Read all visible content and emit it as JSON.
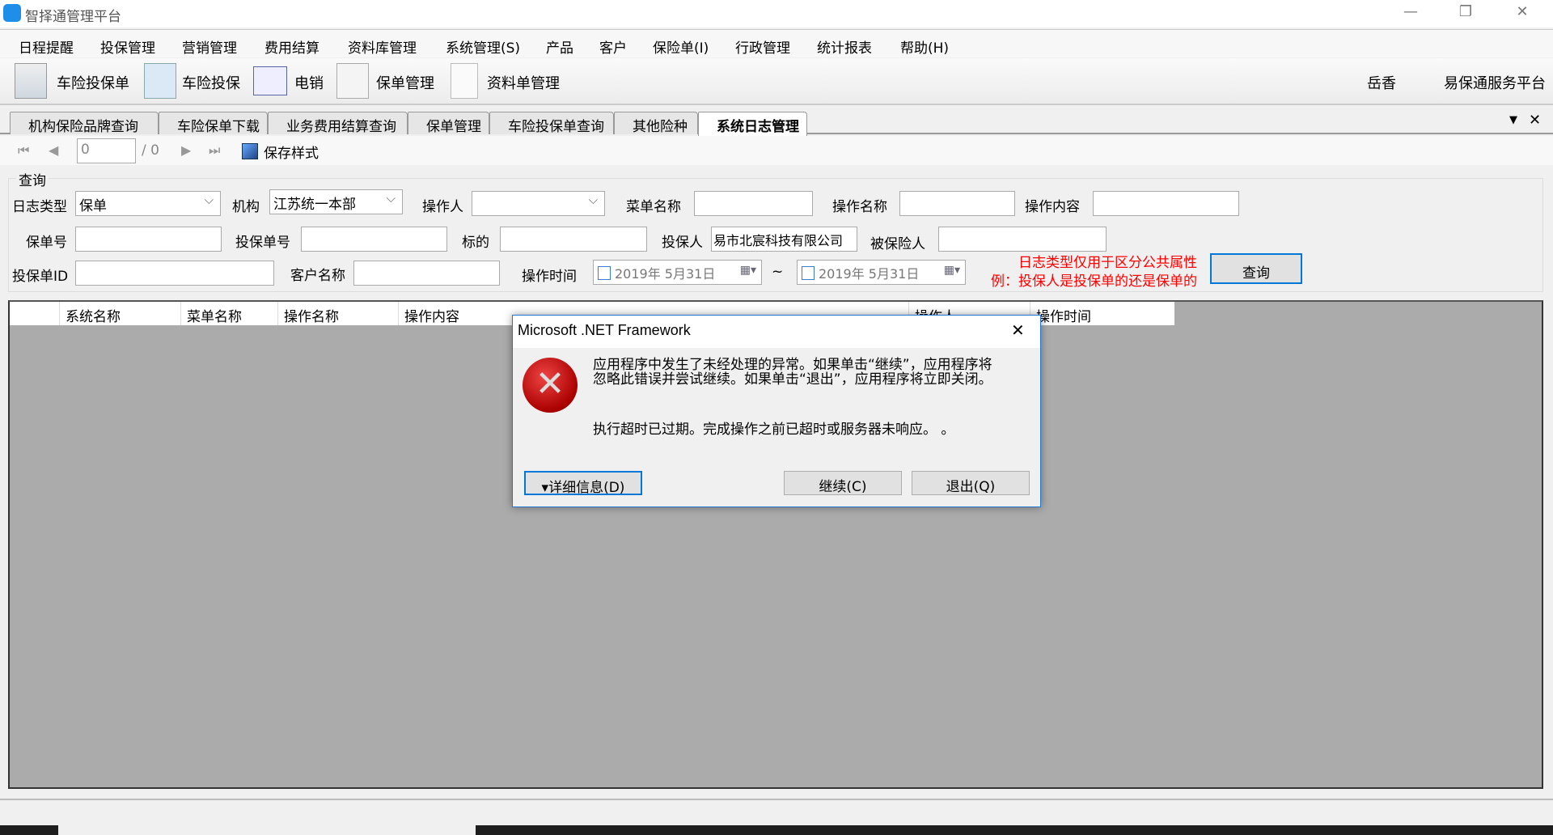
{
  "window": {
    "title": "智择通管理平台",
    "minimize": "—",
    "restore": "❐",
    "close": "✕"
  },
  "menu": [
    "日程提醒",
    "投保管理",
    "营销管理",
    "费用结算",
    "资料库管理",
    "系统管理(S)",
    "产品",
    "客户",
    "保险单(I)",
    "行政管理",
    "统计报表",
    "帮助(H)"
  ],
  "toolbar": {
    "items": [
      "车险投保单",
      "车险投保",
      "电销",
      "保单管理",
      "资料单管理"
    ],
    "user": "岳香",
    "platform": "易保通服务平台"
  },
  "tabs": [
    "机构保险品牌查询",
    "车险保单下载",
    "业务费用结算查询",
    "保单管理",
    "车险投保单查询",
    "其他险种",
    "系统日志管理"
  ],
  "tab_controls": {
    "menu": "▼",
    "close": "✕"
  },
  "nav": {
    "page": "0",
    "total": "/ 0",
    "save_style": "保存样式"
  },
  "query": {
    "group_title": "查询",
    "log_type_label": "日志类型",
    "log_type_value": "保单",
    "org_label": "机构",
    "org_value": "江苏统一本部",
    "operator_label": "操作人",
    "operator_value": "",
    "menu_name_label": "菜单名称",
    "op_name_label": "操作名称",
    "op_content_label": "操作内容",
    "policy_no_label": "保单号",
    "proposal_no_label": "投保单号",
    "subject_label": "标的",
    "applicant_label": "投保人",
    "applicant_value": "易市北宸科技有限公司",
    "insured_label": "被保险人",
    "proposal_id_label": "投保单ID",
    "customer_label": "客户名称",
    "op_time_label": "操作时间",
    "date_from": "2019年 5月31日",
    "tilde": "~",
    "date_to": "2019年 5月31日",
    "note_line1": "日志类型仅用于区分公共属性",
    "note_line2": "例：投保人是投保单的还是保单的",
    "search_button": "查询"
  },
  "grid": {
    "columns": [
      "系统名称",
      "菜单名称",
      "操作名称",
      "操作内容",
      "操作人",
      "操作时间"
    ]
  },
  "dialog": {
    "title": "Microsoft .NET Framework",
    "message": "应用程序中发生了未经处理的异常。如果单击“继续”，应用程序将忽略此错误并尝试继续。如果单击“退出”，应用程序将立即关闭。",
    "detail": "执行超时已过期。完成操作之前已超时或服务器未响应。 。",
    "details_button": "▾详细信息(D)",
    "continue_button": "继续(C)",
    "quit_button": "退出(Q)"
  },
  "colors": {
    "note": "#ff0000",
    "accent": "#0078d7",
    "grid_bg": "#ababab"
  }
}
